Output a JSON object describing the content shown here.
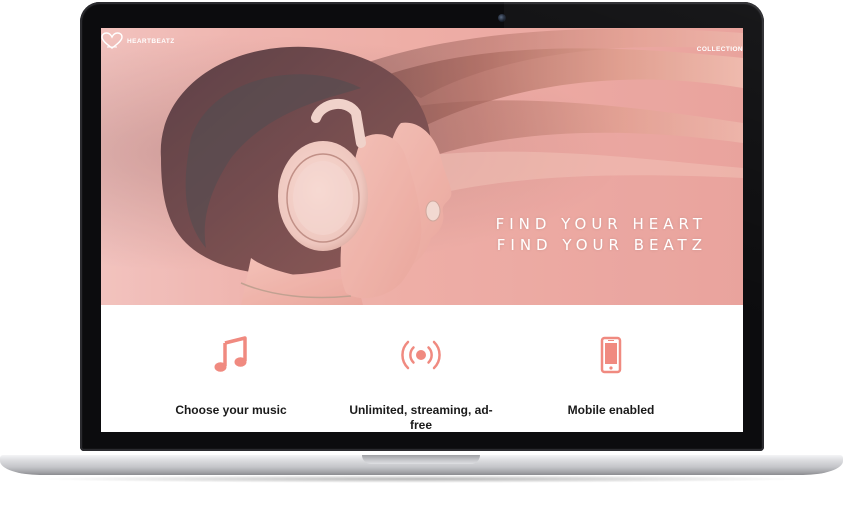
{
  "brand": {
    "name": "HEARTBEATZ",
    "logo_icon": "heart-logo-icon"
  },
  "nav": {
    "link_label": "COLLECTION"
  },
  "hero": {
    "tagline_line1": "FIND YOUR HEART",
    "tagline_line2": "FIND YOUR BEATZ"
  },
  "features": [
    {
      "icon": "music-note-icon",
      "label": "Choose your music"
    },
    {
      "icon": "broadcast-icon",
      "label": "Unlimited, streaming, ad-free"
    },
    {
      "icon": "mobile-phone-icon",
      "label": "Mobile enabled"
    }
  ],
  "colors": {
    "accent": "#f08a80",
    "hero_tint": "#eeb1a9",
    "bezel": "#0c0c0e",
    "text_dark": "#1a1a1a"
  }
}
